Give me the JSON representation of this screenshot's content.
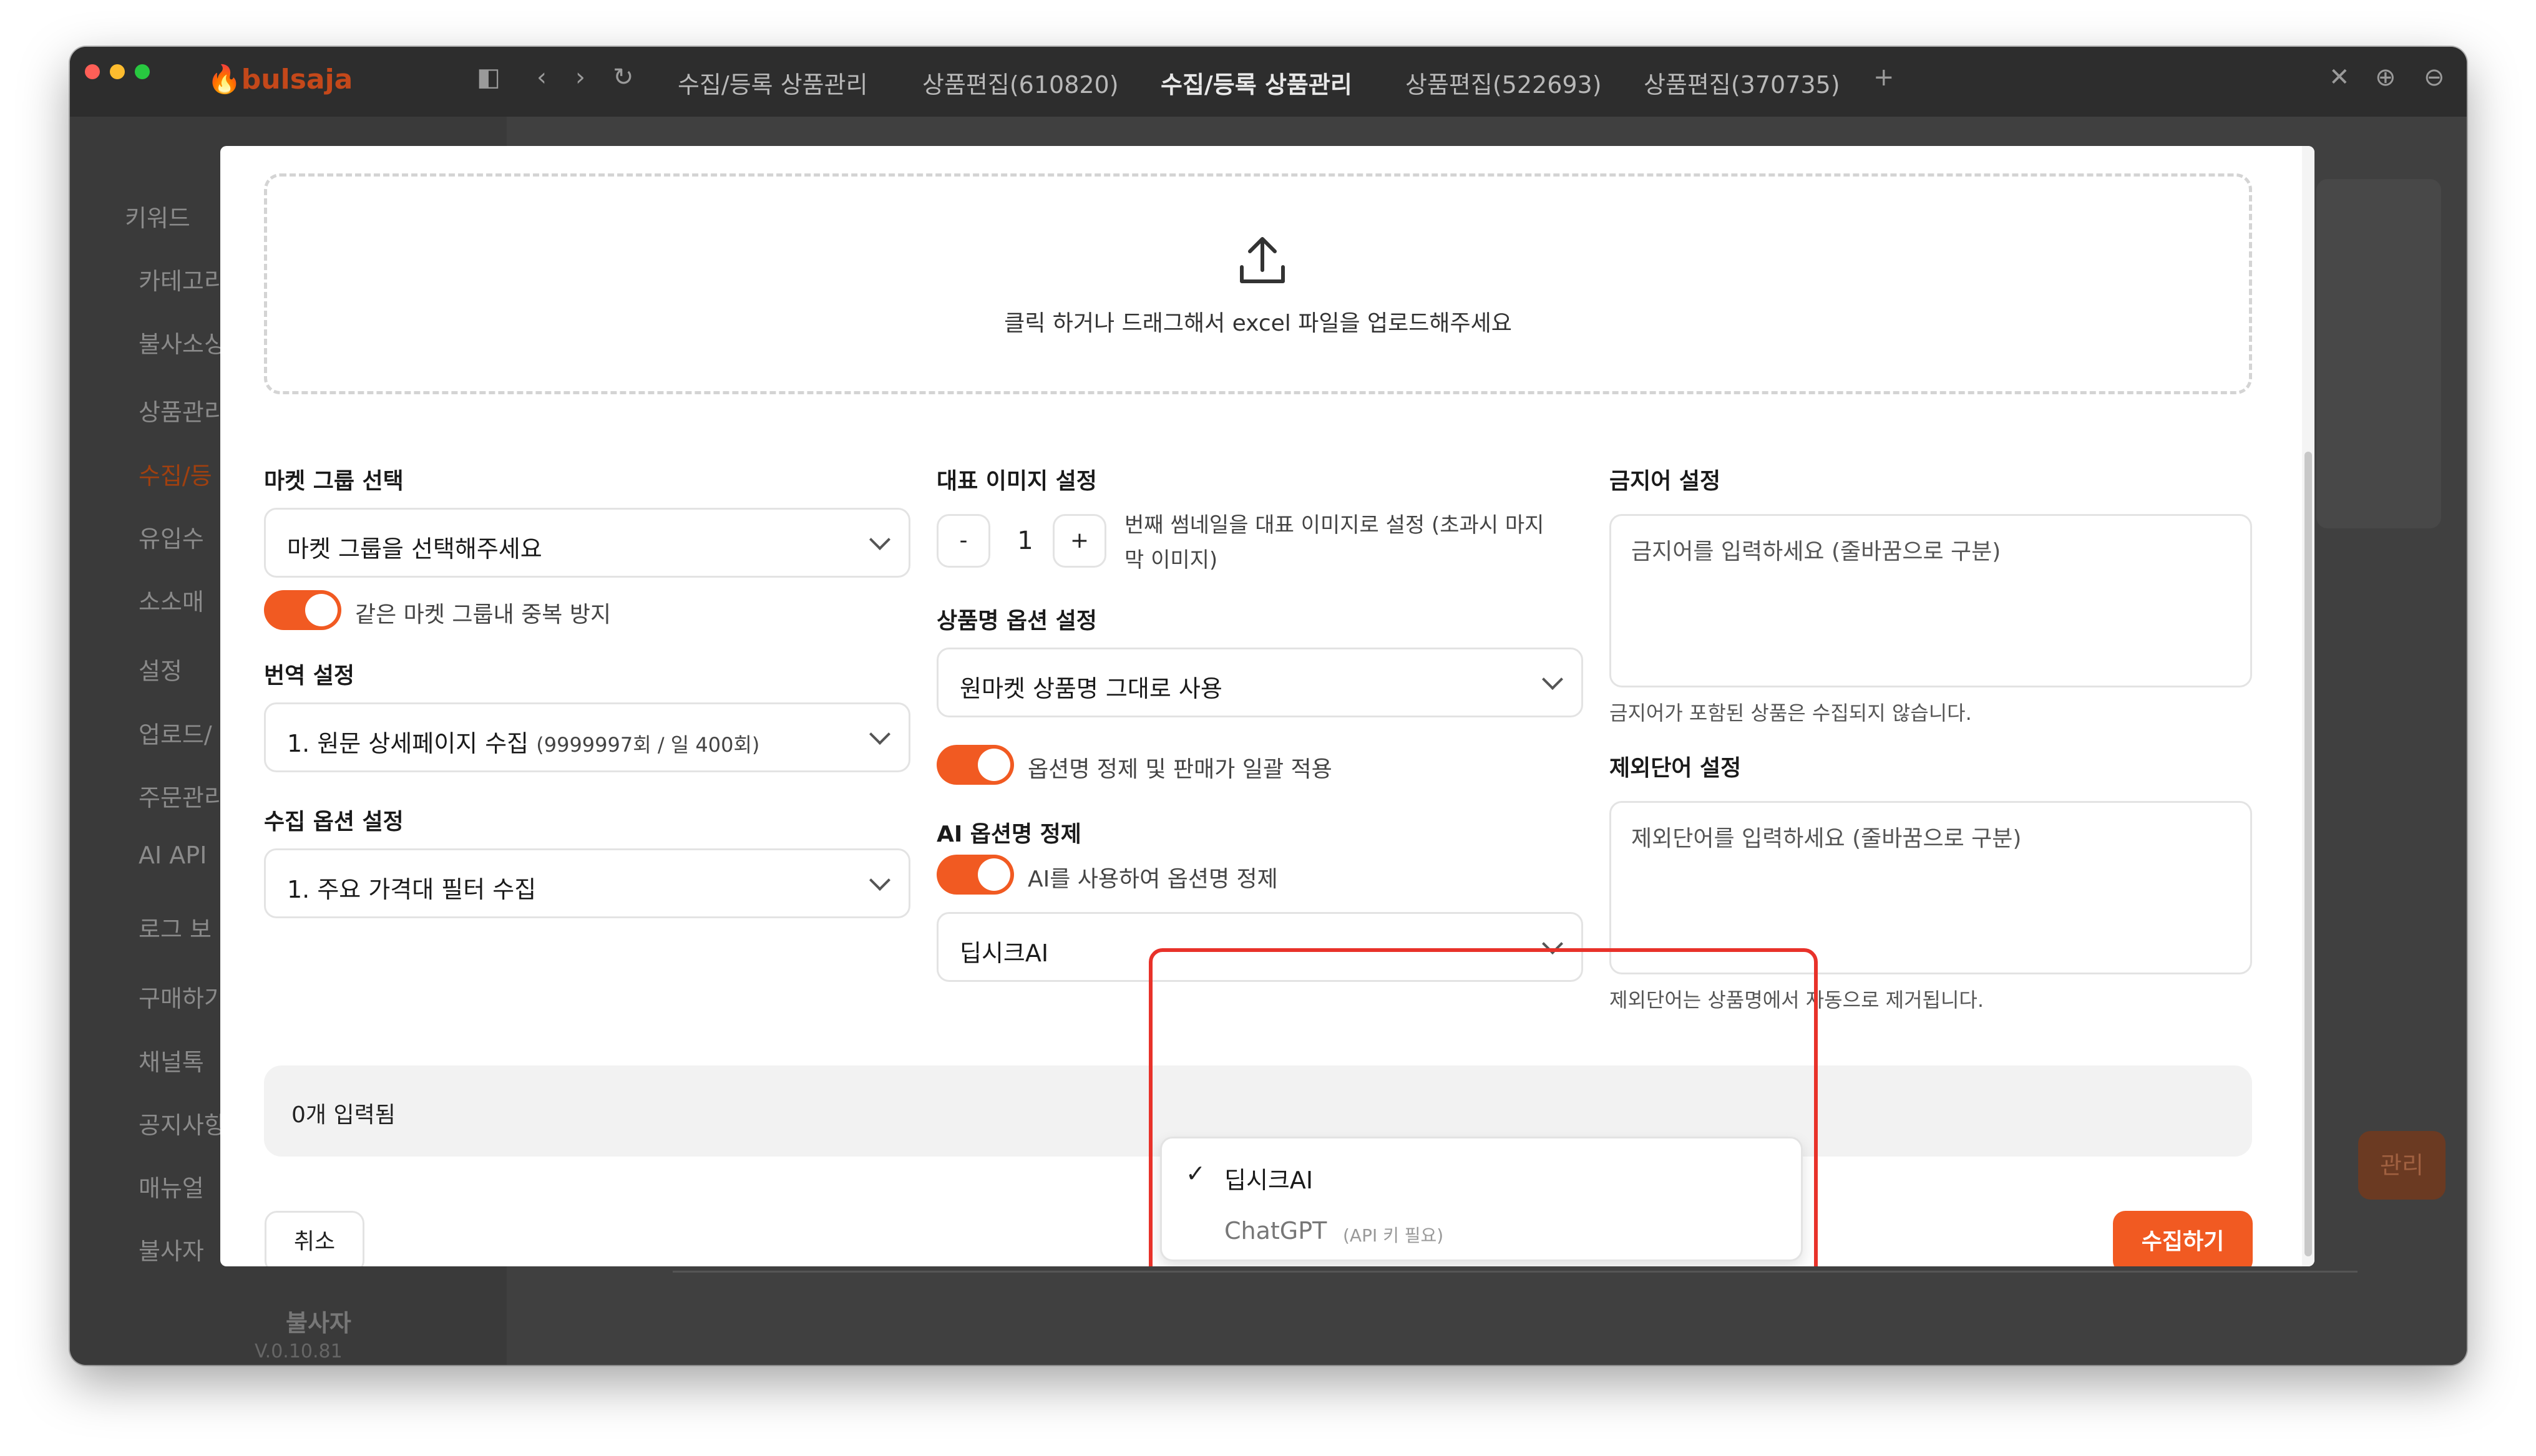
{
  "app": {
    "logo_text": "bulsaja"
  },
  "tabs": [
    {
      "label": "수집/등록 상품관리",
      "active": false
    },
    {
      "label": "상품편집(610820)",
      "active": false
    },
    {
      "label": "수집/등록 상품관리",
      "active": true
    },
    {
      "label": "상품편집(522693)",
      "active": false
    },
    {
      "label": "상품편집(370735)",
      "active": false
    }
  ],
  "titlebar_icons": [
    "sidebar-toggle-icon",
    "back-icon",
    "forward-icon",
    "reload-icon",
    "new-tab-icon",
    "close-icon",
    "zoom-in-icon",
    "zoom-out-icon"
  ],
  "sidebar": {
    "items": [
      {
        "label": "키워드"
      },
      {
        "label": "카테고리"
      },
      {
        "label": "불사소싱"
      },
      {
        "label": "상품관리"
      },
      {
        "label": "수집/등"
      },
      {
        "label": "유입수"
      },
      {
        "label": "소소매"
      },
      {
        "label": "설정"
      },
      {
        "label": "업로드/"
      },
      {
        "label": "주문관리"
      },
      {
        "label": "AI API"
      },
      {
        "label": "로그 보"
      },
      {
        "label": "구매하기"
      },
      {
        "label": "채널톡"
      },
      {
        "label": "공지사항"
      },
      {
        "label": "매뉴얼"
      },
      {
        "label": "불사자"
      }
    ],
    "user_name": "불사자",
    "version": "V.0.10.81"
  },
  "background_button": "관리",
  "upload": {
    "text": "클릭 하거나 드래그해서 excel 파일을 업로드해주세요"
  },
  "market_group": {
    "label": "마켓 그룹 선택",
    "placeholder": "마켓 그룹을 선택해주세요",
    "toggle_label": "같은 마켓 그룹내 중복 방지",
    "toggle_on": true
  },
  "translation": {
    "label": "번역 설정",
    "value_main": "1. 원문 상세페이지 수집",
    "value_sub": "(9999997회 / 일 400회)"
  },
  "collect_option": {
    "label": "수집 옵션 설정",
    "value": "1. 주요 가격대 필터 수집"
  },
  "thumbnail": {
    "label": "대표 이미지 설정",
    "minus": "-",
    "value": "1",
    "plus": "+",
    "desc_line1": "번째 썸네일을 대표 이미지로 설정 (초과시 마지",
    "desc_line2": "막 이미지)"
  },
  "product_name_option": {
    "label": "상품명 옵션 설정",
    "value": "원마켓 상품명 그대로 사용",
    "toggle_label": "옵션명 정제 및 판매가 일괄 적용",
    "toggle_on": true
  },
  "ai_option": {
    "label": "AI 옵션명 정제",
    "toggle_label": "AI를 사용하여 옵션명 정제",
    "toggle_on": true,
    "selected": "딥시크AI",
    "options": [
      {
        "label": "딥시크AI",
        "checked": true,
        "note": ""
      },
      {
        "label": "ChatGPT",
        "checked": false,
        "note": "(API 키 필요)"
      }
    ]
  },
  "banned_words": {
    "label": "금지어 설정",
    "placeholder": "금지어를 입력하세요 (줄바꿈으로 구분)",
    "hint": "금지어가 포함된 상품은 수집되지 않습니다."
  },
  "excluded_words": {
    "label": "제외단어 설정",
    "placeholder": "제외단어를 입력하세요 (줄바꿈으로 구분)",
    "hint": "제외단어는 상품명에서 자동으로 제거됩니다."
  },
  "counter": {
    "text": "0개 입력됨"
  },
  "buttons": {
    "cancel": "취소",
    "submit": "수집하기"
  },
  "colors": {
    "accent": "#f15a22",
    "highlight": "#e8322a"
  }
}
